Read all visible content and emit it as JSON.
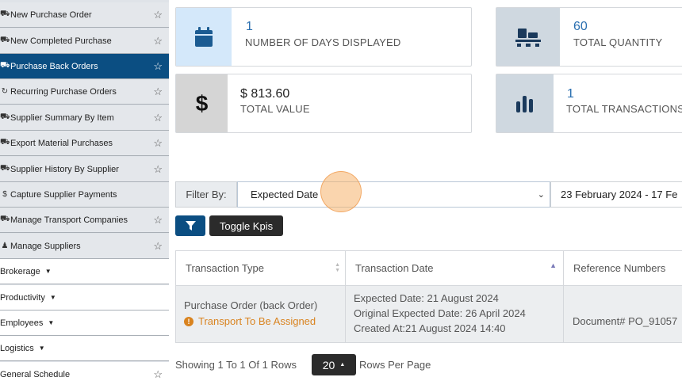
{
  "sidebar": {
    "items": [
      {
        "label": "New Purchase Order",
        "icon": "truck-icon",
        "star": true
      },
      {
        "label": "New Completed Purchase",
        "icon": "truck-icon",
        "star": true
      },
      {
        "label": "Purchase Back Orders",
        "icon": "truck-icon",
        "star": true,
        "active": true
      },
      {
        "label": "Recurring Purchase Orders",
        "icon": "refresh-icon",
        "star": true
      },
      {
        "label": "Supplier Summary By Item",
        "icon": "truck-icon",
        "star": true
      },
      {
        "label": "Export Material Purchases",
        "icon": "truck-icon",
        "star": true
      },
      {
        "label": "Supplier History By Supplier",
        "icon": "truck-icon",
        "star": true
      },
      {
        "label": "Capture Supplier Payments",
        "icon": "dollar-icon",
        "star": false
      },
      {
        "label": "Manage Transport Companies",
        "icon": "truck-icon",
        "star": true
      },
      {
        "label": "Manage Suppliers",
        "icon": "users-icon",
        "star": true
      },
      {
        "label": "Brokerage",
        "caret": true
      },
      {
        "label": "Productivity",
        "caret": true
      },
      {
        "label": "Employees",
        "caret": true
      },
      {
        "label": "Logistics",
        "caret": true
      },
      {
        "label": "General Schedule",
        "star": true
      }
    ]
  },
  "kpis": {
    "days": {
      "value": "1",
      "label": "NUMBER OF DAYS DISPLAYED",
      "icon": "calendar-icon"
    },
    "quantity": {
      "value": "60",
      "label": "TOTAL QUANTITY",
      "icon": "pallet-icon"
    },
    "value": {
      "value": "$ 813.60",
      "label": "TOTAL VALUE",
      "icon": "dollar-icon"
    },
    "transactions": {
      "value": "1",
      "label": "TOTAL TRANSACTIONS",
      "icon": "bar-chart-icon"
    }
  },
  "filter": {
    "label": "Filter By:",
    "selected": "Expected Date",
    "date_range": "23 February 2024 - 17 Fe"
  },
  "buttons": {
    "toggle_kpis": "Toggle Kpis"
  },
  "table": {
    "headers": [
      "Transaction Type",
      "Transaction Date",
      "Reference Numbers"
    ],
    "rows": [
      {
        "type": "Purchase Order (back Order)",
        "status": "Transport To Be Assigned",
        "expected": "Expected Date: 21 August 2024",
        "original": "Original Expected Date: 26 April 2024",
        "created": "Created At:21 August 2024 14:40",
        "reference": "Document# PO_91057"
      }
    ]
  },
  "pager": {
    "summary": "Showing 1 To 1 Of 1 Rows",
    "page_size": "20",
    "suffix": "Rows Per Page"
  },
  "colors": {
    "primary": "#0b4e82",
    "dark_button": "#2b2b2b",
    "warning": "#d9831f",
    "kpi_blue_bg": "#d4e8fa",
    "kpi_gray_bg": "#cfd8e0",
    "kpi_value_blue": "#2a6fb0"
  }
}
